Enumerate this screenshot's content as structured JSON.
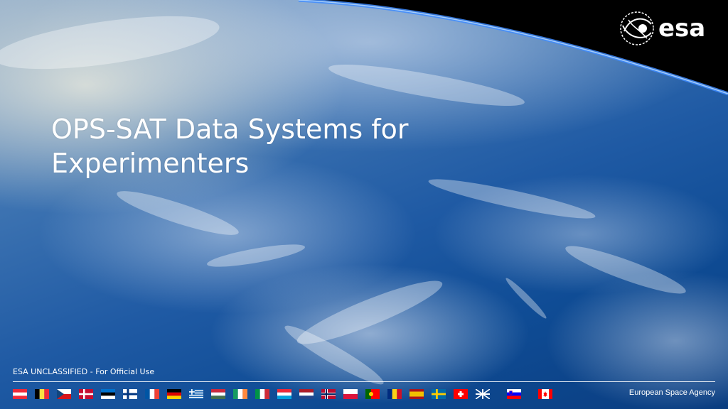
{
  "slide": {
    "title_line1": "OPS-SAT Data Systems for",
    "title_line2": "Experimenters",
    "classification": "ESA UNCLASSIFIED - For Official Use",
    "agency": "European Space Agency",
    "logo_text": "esa"
  },
  "flags": [
    "austria",
    "belgium",
    "czech-republic",
    "denmark",
    "estonia",
    "finland",
    "france",
    "germany",
    "greece",
    "hungary",
    "ireland",
    "italy",
    "luxembourg",
    "netherlands",
    "norway",
    "poland",
    "portugal",
    "romania",
    "spain",
    "sweden",
    "switzerland",
    "united-kingdom",
    "slovenia",
    "canada"
  ],
  "colors": {
    "space_black": "#000000",
    "ocean_blue": "#1f5aa4",
    "text": "#ffffff"
  }
}
